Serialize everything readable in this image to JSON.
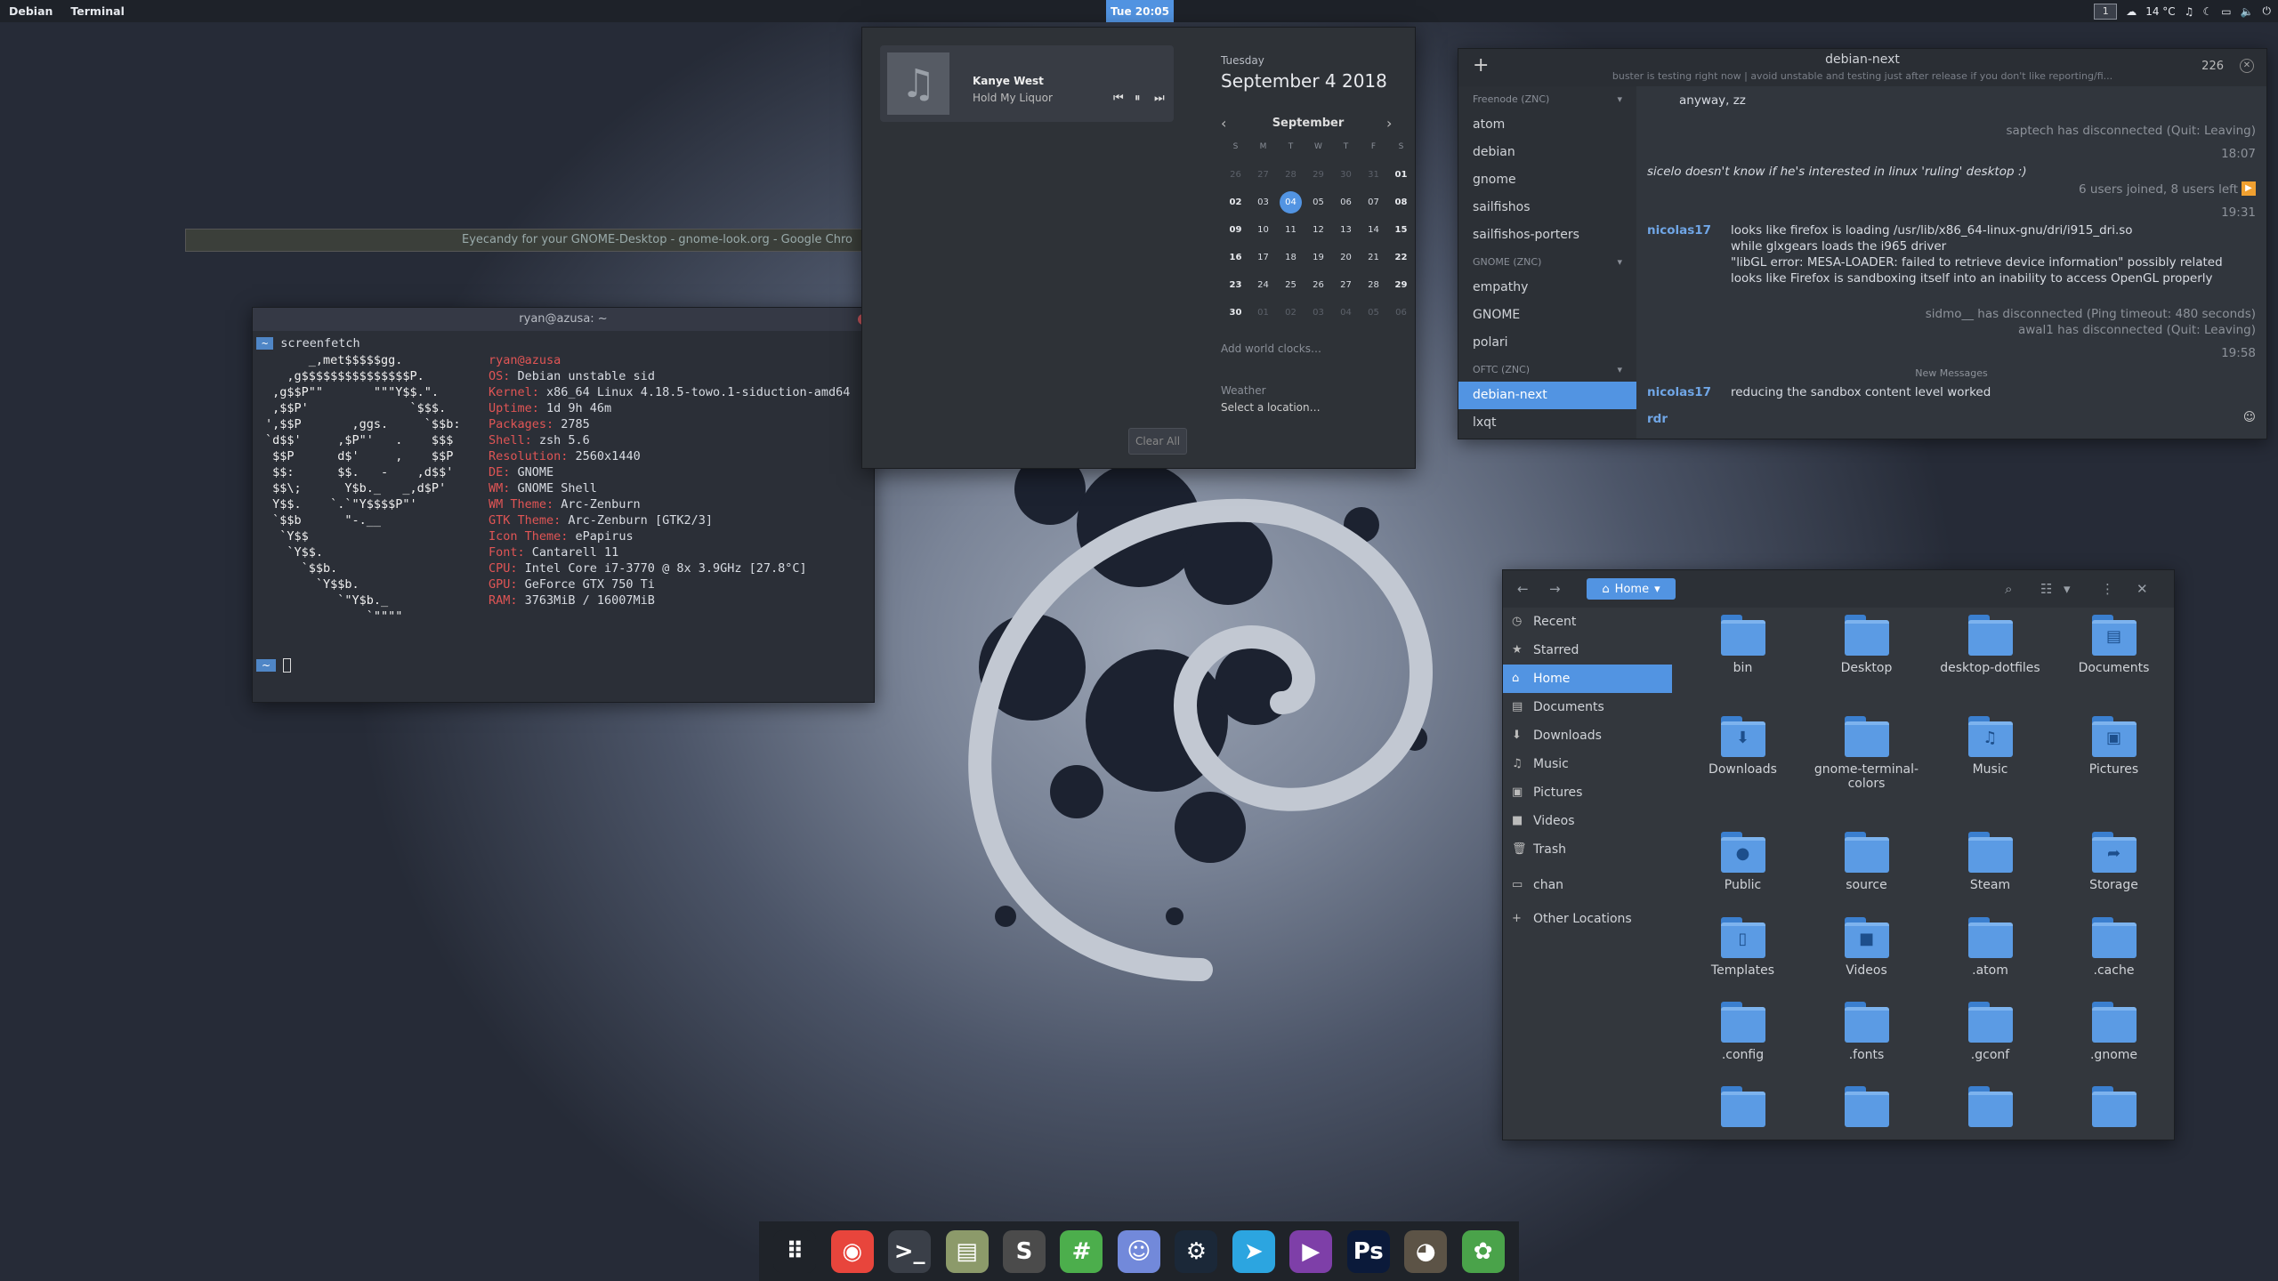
{
  "topbar": {
    "activities": "Debian",
    "app": "Terminal",
    "clock": "Tue 20:05",
    "workspace": "1",
    "weather": "14 °C"
  },
  "chrome": {
    "title": "Eyecandy for your GNOME-Desktop - gnome-look.org - Google Chro"
  },
  "terminal": {
    "title": "ryan@azusa: ~",
    "prompt": "~",
    "command": "screenfetch",
    "user": "ryan",
    "host": "azusa",
    "info": [
      {
        "k": "OS:",
        "v": "Debian unstable sid"
      },
      {
        "k": "Kernel:",
        "v": "x86_64 Linux 4.18.5-towo.1-siduction-amd64"
      },
      {
        "k": "Uptime:",
        "v": "1d 9h 46m"
      },
      {
        "k": "Packages:",
        "v": "2785"
      },
      {
        "k": "Shell:",
        "v": "zsh 5.6"
      },
      {
        "k": "Resolution:",
        "v": "2560x1440"
      },
      {
        "k": "DE:",
        "v": "GNOME"
      },
      {
        "k": "WM:",
        "v": "GNOME Shell"
      },
      {
        "k": "WM Theme:",
        "v": "Arc-Zenburn"
      },
      {
        "k": "GTK Theme:",
        "v": "Arc-Zenburn [GTK2/3]"
      },
      {
        "k": "Icon Theme:",
        "v": "ePapirus"
      },
      {
        "k": "Font:",
        "v": "Cantarell 11"
      },
      {
        "k": "CPU:",
        "v": "Intel Core i7-3770 @ 8x 3.9GHz [27.8°C]"
      },
      {
        "k": "GPU:",
        "v": "GeForce GTX 750 Ti"
      },
      {
        "k": "RAM:",
        "v": "3763MiB / 16007MiB"
      }
    ],
    "logo": [
      "      _,met$$$$$gg.",
      "   ,g$$$$$$$$$$$$$$$P.",
      " ,g$$P\"\"       \"\"\"Y$$.\".",
      " ,$$P'              `$$$.",
      "',$$P       ,ggs.     `$$b:",
      "`d$$'     ,$P\"'   .    $$$",
      " $$P      d$'     ,    $$P",
      " $$:      $$.   -    ,d$$'",
      " $$\\;      Y$b._   _,d$P'",
      " Y$$.    `.`\"Y$$$$P\"'",
      " `$$b      \"-.__",
      "  `Y$$",
      "   `Y$$.",
      "     `$$b.",
      "       `Y$$b.",
      "          `\"Y$b._",
      "              `\"\"\"\""
    ]
  },
  "media": {
    "artist": "Kanye West",
    "song": "Hold My Liquor"
  },
  "calendar": {
    "day": "Tuesday",
    "date": "September  4 2018",
    "month": "September",
    "headers": [
      "S",
      "M",
      "T",
      "W",
      "T",
      "F",
      "S"
    ],
    "weeks": [
      [
        "26",
        "27",
        "28",
        "29",
        "30",
        "31",
        "01"
      ],
      [
        "02",
        "03",
        "04",
        "05",
        "06",
        "07",
        "08"
      ],
      [
        "09",
        "10",
        "11",
        "12",
        "13",
        "14",
        "15"
      ],
      [
        "16",
        "17",
        "18",
        "19",
        "20",
        "21",
        "22"
      ],
      [
        "23",
        "24",
        "25",
        "26",
        "27",
        "28",
        "29"
      ],
      [
        "30",
        "01",
        "02",
        "03",
        "04",
        "05",
        "06"
      ]
    ],
    "world_clocks": "Add world clocks…",
    "weather_title": "Weather",
    "weather_loc": "Select a location…",
    "clear": "Clear All"
  },
  "chat": {
    "title": "debian-next",
    "topic": "buster is testing right now | avoid unstable and testing just after release if you don't like reporting/fi...",
    "users": "226",
    "groups": [
      {
        "name": "Freenode (ZNC)",
        "channels": [
          "atom",
          "debian",
          "gnome",
          "sailfishos",
          "sailfishos-porters"
        ]
      },
      {
        "name": "GNOME (ZNC)",
        "channels": [
          "empathy",
          "GNOME",
          "polari"
        ]
      },
      {
        "name": "OFTC (ZNC)",
        "channels": [
          "debian-next",
          "lxqt"
        ]
      }
    ],
    "selected": "debian-next",
    "messages": {
      "m1": "anyway, zz",
      "m2": "saptech has disconnected (Quit: Leaving)",
      "t1": "18:07",
      "m3": "sicelo doesn't know if he's interested in linux 'ruling' desktop :)",
      "m4": "6 users joined, 8 users left",
      "t2": "19:31",
      "nick1": "nicolas17",
      "l1": "looks like firefox is loading /usr/lib/x86_64-linux-gnu/dri/i915_dri.so",
      "l2": "while glxgears loads the i965 driver",
      "l3": "\"libGL error: MESA-LOADER: failed to retrieve device information\" possibly related",
      "l4": "looks like Firefox is sandboxing itself into an inability to access OpenGL properly",
      "m5": "sidmo__ has disconnected (Ping timeout: 480 seconds)",
      "m6": "awal1 has disconnected (Quit: Leaving)",
      "t3": "19:58",
      "new": "New Messages",
      "nick2": "nicolas17",
      "l5": "reducing the sandbox content level worked",
      "input_nick": "rdr"
    }
  },
  "files": {
    "location": "Home",
    "sidebar": [
      "Recent",
      "Starred",
      "Home",
      "Documents",
      "Downloads",
      "Music",
      "Pictures",
      "Videos",
      "Trash",
      "chan",
      "Other Locations"
    ],
    "items": [
      {
        "name": "bin",
        "glyph": ""
      },
      {
        "name": "Desktop",
        "glyph": ""
      },
      {
        "name": "desktop-dotfiles",
        "glyph": ""
      },
      {
        "name": "Documents",
        "glyph": "▤"
      },
      {
        "name": "Downloads",
        "glyph": "⬇"
      },
      {
        "name": "gnome-terminal-colors",
        "glyph": ""
      },
      {
        "name": "Music",
        "glyph": "♫"
      },
      {
        "name": "Pictures",
        "glyph": "▣"
      },
      {
        "name": "Public",
        "glyph": "●"
      },
      {
        "name": "source",
        "glyph": ""
      },
      {
        "name": "Steam",
        "glyph": ""
      },
      {
        "name": "Storage",
        "glyph": "➦"
      },
      {
        "name": "Templates",
        "glyph": "▯"
      },
      {
        "name": "Videos",
        "glyph": "■"
      },
      {
        "name": ".atom",
        "glyph": ""
      },
      {
        "name": ".cache",
        "glyph": ""
      },
      {
        "name": ".config",
        "glyph": ""
      },
      {
        "name": ".fonts",
        "glyph": ""
      },
      {
        "name": ".gconf",
        "glyph": ""
      },
      {
        "name": ".gnome",
        "glyph": ""
      },
      {
        "name": "",
        "glyph": ""
      },
      {
        "name": "",
        "glyph": ""
      },
      {
        "name": "",
        "glyph": ""
      },
      {
        "name": "",
        "glyph": ""
      }
    ]
  },
  "dock": [
    {
      "name": "app-grid-icon",
      "color": "#1f2329",
      "glyph": "⠿"
    },
    {
      "name": "chrome-icon",
      "color": "#e8453c",
      "glyph": "◉"
    },
    {
      "name": "terminal-icon",
      "color": "#3a3f48",
      "glyph": ">_"
    },
    {
      "name": "files-icon",
      "color": "#8c9a6a",
      "glyph": "▤"
    },
    {
      "name": "sublime-icon",
      "color": "#4b4b4b",
      "glyph": "S"
    },
    {
      "name": "hexchat-icon",
      "color": "#4cae4c",
      "glyph": "#"
    },
    {
      "name": "discord-icon",
      "color": "#7289da",
      "glyph": "☺"
    },
    {
      "name": "steam-icon",
      "color": "#1b2838",
      "glyph": "⚙"
    },
    {
      "name": "telegram-icon",
      "color": "#2ca5e0",
      "glyph": "➤"
    },
    {
      "name": "media-player-icon",
      "color": "#7e3fa8",
      "glyph": "▶"
    },
    {
      "name": "photoshop-icon",
      "color": "#0b1a3a",
      "glyph": "Ps"
    },
    {
      "name": "gimp-icon",
      "color": "#5c5346",
      "glyph": "◕"
    },
    {
      "name": "store-icon",
      "color": "#4aa34a",
      "glyph": "✿"
    }
  ]
}
